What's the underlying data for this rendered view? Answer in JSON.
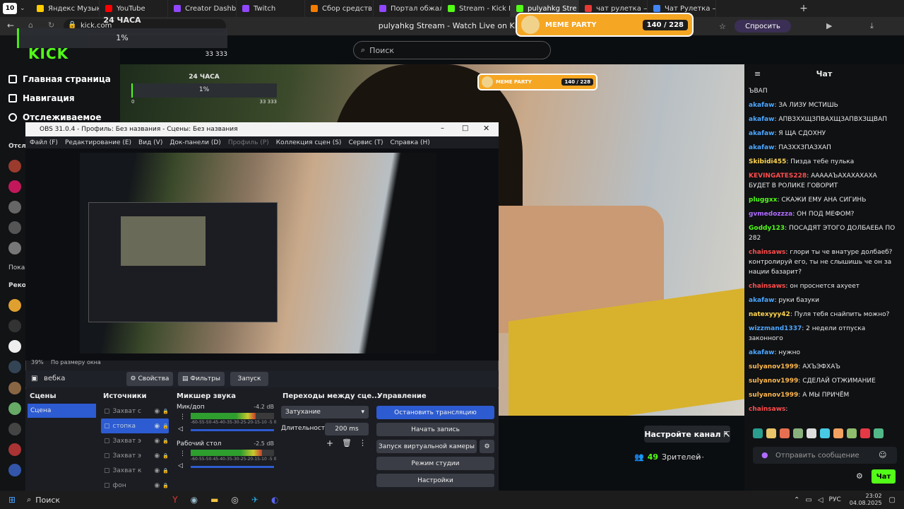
{
  "browser": {
    "tab_count": "10",
    "tabs": [
      {
        "label": "Яндекс Музыка",
        "color": "#ffcc00"
      },
      {
        "label": "YouTube",
        "color": "#ff0000"
      },
      {
        "label": "Creator Dashboar",
        "color": "#9147ff"
      },
      {
        "label": "Twitch",
        "color": "#9147ff"
      },
      {
        "label": "Сбор средств - В",
        "color": "#f57c00"
      },
      {
        "label": "Портал обжалов",
        "color": "#9147ff"
      },
      {
        "label": "Stream - Kick Das",
        "color": "#53fc18"
      },
      {
        "label": "pulyahkg Stre",
        "color": "#53fc18"
      },
      {
        "label": "чат рулетка — Ян",
        "color": "#e53935"
      },
      {
        "label": "Чат Рулетка — за",
        "color": "#4285f4"
      }
    ],
    "url": "kick.com",
    "page_title": "pulyahkg Stream - Watch Live on Kick",
    "ask_label": "Спросить"
  },
  "overlay": {
    "stat_label": "24 ЧАСА",
    "stat_percent": "1%",
    "stat_min": "0",
    "stat_max": "33 333",
    "meme_label": "MEME PARTY",
    "meme_count": "140 / 228"
  },
  "kick": {
    "logo": "KICK",
    "nav": [
      "Главная страница",
      "Навигация",
      "Отслеживаемое"
    ],
    "side_labels": [
      "Отсл",
      "Показ",
      "Реко"
    ],
    "search_placeholder": "Поиск",
    "setup_channel": "Настройте канал",
    "viewers_count": "49",
    "viewers_label": "Зрителей"
  },
  "chat": {
    "title": "Чат",
    "messages": [
      {
        "user": "",
        "color": "#ffffff",
        "text": "ЪВАП"
      },
      {
        "user": "akafaw",
        "color": "#4da6ff",
        "text": ": ЗА ЛИЗУ МСТИШЬ"
      },
      {
        "user": "akafaw",
        "color": "#4da6ff",
        "text": ": АПВЗХХЩЗПВАХЩЗАПВХЗЩВАП"
      },
      {
        "user": "akafaw",
        "color": "#4da6ff",
        "text": ": Я ЩА СДОХНУ"
      },
      {
        "user": "akafaw",
        "color": "#4da6ff",
        "text": ": ПАЗХХЗПАЗХАП"
      },
      {
        "user": "Skibidi455",
        "color": "#ffd54f",
        "text": ": Пизда тебе пулька"
      },
      {
        "user": "KEVINGATES228",
        "color": "#ff4d4d",
        "text": ": АААААЪАХАХАХАХА БУДЕТ В РОЛИКЕ ГОВОРИТ"
      },
      {
        "user": "pluggxx",
        "color": "#53fc18",
        "text": ": СКАЖИ ЕМУ АНА СИГИНЬ"
      },
      {
        "user": "gvmedozzza",
        "color": "#b06bff",
        "text": ": ОН ПОД МЕФОМ?"
      },
      {
        "user": "Goddy123",
        "color": "#53fc18",
        "text": ": ПОСАДЯТ ЭТОГО ДОЛБАЕБА ПО 282"
      },
      {
        "user": "chainsaws",
        "color": "#ff4d4d",
        "text": ": глори ты че внатуре долбаеб? контролируй его, ты не слышишь че он за нации базарит?"
      },
      {
        "user": "chainsaws",
        "color": "#ff4d4d",
        "text": ": он проснется ахуеет"
      },
      {
        "user": "akafaw",
        "color": "#4da6ff",
        "text": ": руки базуки"
      },
      {
        "user": "natexyyy42",
        "color": "#ffd54f",
        "text": ": Пуля тебя снайпить можно?"
      },
      {
        "user": "wizzmand1337",
        "color": "#4da6ff",
        "text": ": 2 недели отпуска законного"
      },
      {
        "user": "akafaw",
        "color": "#4da6ff",
        "text": ": нужно"
      },
      {
        "user": "sulyanov1999",
        "color": "#ffb74d",
        "text": ": АХЪЭФХАЪ"
      },
      {
        "user": "sulyanov1999",
        "color": "#ffb74d",
        "text": ": СДЕЛАЙ ОТЖИМАНИЕ"
      },
      {
        "user": "sulyanov1999",
        "color": "#ffb74d",
        "text": ": А МЫ ПРИЧЁМ"
      },
      {
        "user": "chainsaws",
        "color": "#ff4d4d",
        "text": ":"
      }
    ],
    "input_placeholder": "Отправить сообщение",
    "send_label": "Чат"
  },
  "obs": {
    "title": "OBS 31.0.4 - Профиль: Без названия - Сцены: Без названия",
    "menu": [
      "Файл (F)",
      "Редактирование (E)",
      "Вид (V)",
      "Док-панели (D)",
      "Профиль (P)",
      "Коллекция сцен (S)",
      "Сервис (T)",
      "Справка (H)"
    ],
    "zoom": "39%",
    "zoom_label": "По размеру окна",
    "source_name": "вебка",
    "properties": "Свойства",
    "filters": "Фильтры",
    "launch": "Запуск",
    "docks": {
      "scenes": "Сцены",
      "sources": "Источники",
      "mixer": "Микшер звука",
      "transitions": "Переходы между сце...",
      "controls": "Управление"
    },
    "scene_item": "Сцена",
    "sources_list": [
      "Захват с",
      "стопка",
      "Захват э",
      "Захват э",
      "Захват к",
      "фон"
    ],
    "mixer": [
      {
        "name": "Мик/доп",
        "db": "-4.2 dB",
        "level": 0.78
      },
      {
        "name": "Рабочий стол",
        "db": "-2.5 dB",
        "level": 0.86
      }
    ],
    "mixer_scale": "-60-55-50-45-40-35-30-25-20-15-10 -5  0",
    "transition": "Затухание",
    "duration_label": "Длительность",
    "duration": "200 ms",
    "controls_buttons": [
      "Остановить трансляцию",
      "Начать запись",
      "Запуск виртуальной камеры",
      "Режим студии",
      "Настройки"
    ]
  },
  "taskbar": {
    "search": "Поиск",
    "lang": "РУС",
    "time": "23:02",
    "date": "04.08.2025"
  }
}
